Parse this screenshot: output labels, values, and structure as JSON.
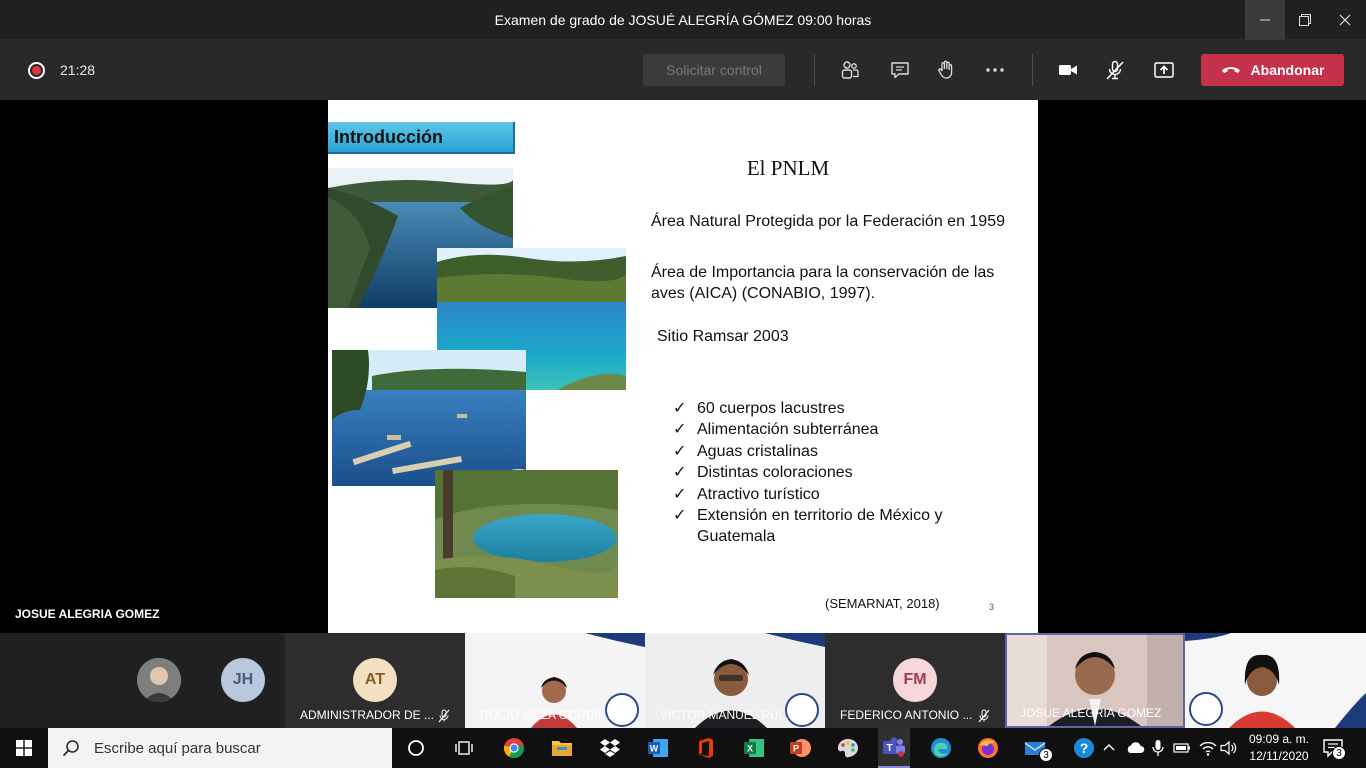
{
  "window": {
    "title": "Examen de grado de JOSUÉ ALEGRÍA GÓMEZ 09:00 horas"
  },
  "toolbar": {
    "timer": "21:28",
    "request_control_label": "Solicitar control",
    "leave_label": "Abandonar"
  },
  "presenter": {
    "name": "JOSUE ALEGRIA GOMEZ"
  },
  "slide": {
    "section_label": "Introducción",
    "title": "El PNLM",
    "paragraph_1": "Área Natural Protegida por la Federación en 1959",
    "paragraph_2": "Área de Importancia para la conservación de las aves (AICA) (CONABIO, 1997).",
    "paragraph_3": "Sitio Ramsar 2003",
    "bullets": [
      "60 cuerpos lacustres",
      "Alimentación subterránea",
      "Aguas cristalinas",
      "Distintas coloraciones",
      "Atractivo turístico",
      "Extensión en territorio de México y Guatemala"
    ],
    "check_glyph": "✓",
    "citation": "(SEMARNAT, 2018)",
    "page_number": "3"
  },
  "participants": [
    {
      "initials": "JH"
    },
    {
      "initials": "AT",
      "name": "ADMINISTRADOR DE ..."
    },
    {
      "name": "ROCÍO MEZA GORDIL..."
    },
    {
      "name": "VICTOR MANUEL RUI..."
    },
    {
      "initials": "FM",
      "name": "FEDERICO ANTONIO ..."
    },
    {
      "name": "JOSUE ALEGRIA GOMEZ"
    }
  ],
  "taskbar": {
    "search_placeholder": "Escribe aquí para buscar",
    "mail_badge": "3",
    "time": "09:09 a. m.",
    "date": "12/11/2020",
    "notifications_count": "3"
  },
  "colors": {
    "leave_red": "#c4314b",
    "record_red": "#e0343f",
    "banner_blue": "#2aa3d2",
    "titlebar": "#202020",
    "toolbar": "#292929"
  }
}
